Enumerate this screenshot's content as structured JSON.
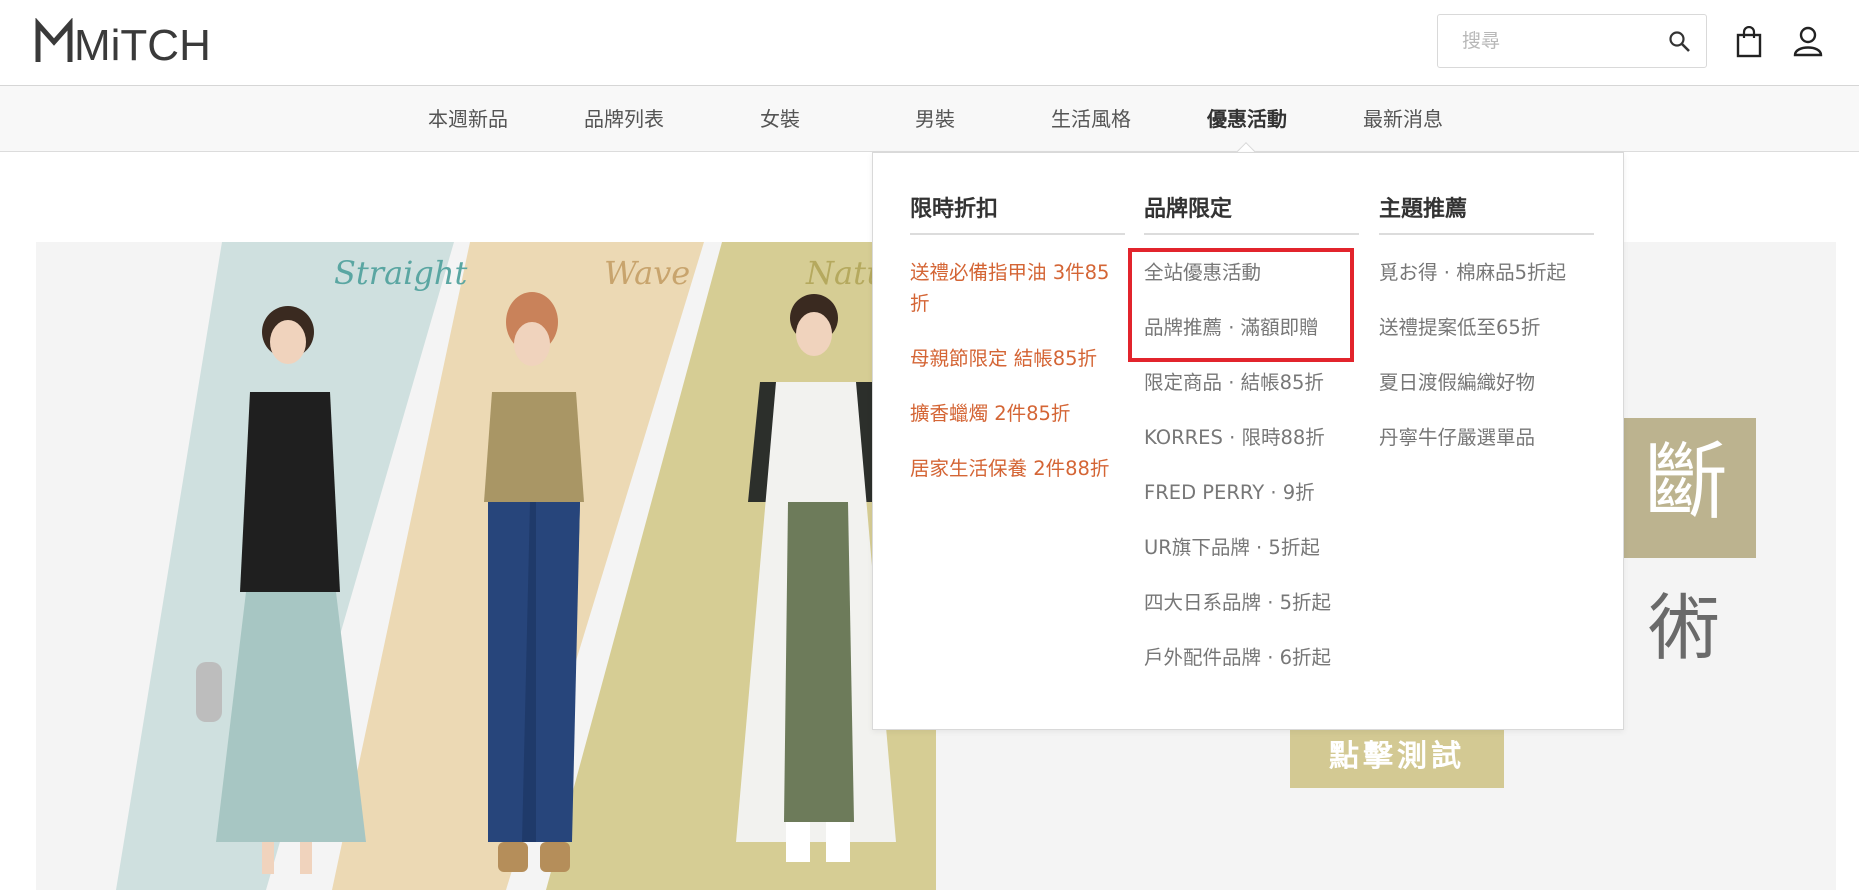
{
  "brand": {
    "logo_text": "MiTCH"
  },
  "search": {
    "placeholder": "搜尋"
  },
  "nav": {
    "items": [
      "本週新品",
      "品牌列表",
      "女裝",
      "男裝",
      "生活風格",
      "優惠活動",
      "最新消息"
    ],
    "active_index": 5
  },
  "dropdown": {
    "columns": [
      {
        "title": "限時折扣",
        "links": [
          "送禮必備指甲油 3件85折",
          "母親節限定 結帳85折",
          "擴香蠟燭 2件85折",
          "居家生活保養 2件88折"
        ]
      },
      {
        "title": "品牌限定",
        "links": [
          "全站優惠活動",
          "品牌推薦 · 滿額即贈",
          "限定商品 · 結帳85折",
          "KORRES · 限時88折",
          "FRED PERRY · 9折",
          "UR旗下品牌 · 5折起",
          "四大日系品牌 · 5折起",
          "戶外配件品牌 · 6折起"
        ]
      },
      {
        "title": "主題推薦",
        "links": [
          "覓お得 · 棉麻品5折起",
          "送禮提案低至65折",
          "夏日渡假編織好物",
          "丹寧牛仔嚴選單品"
        ]
      }
    ]
  },
  "banner": {
    "script_labels": [
      "Straight",
      "Wave",
      "Natu"
    ],
    "char_1": "斷",
    "char_2": "術",
    "cta": "點擊測試"
  },
  "colors": {
    "accent_red": "#d46535",
    "highlight_red": "#e2242c",
    "strip_teal": "#cfe0df",
    "strip_beige": "#ecd9b4",
    "strip_khaki": "#d6cd94"
  },
  "icons": [
    "logo",
    "search-icon",
    "bag-icon",
    "user-icon"
  ]
}
